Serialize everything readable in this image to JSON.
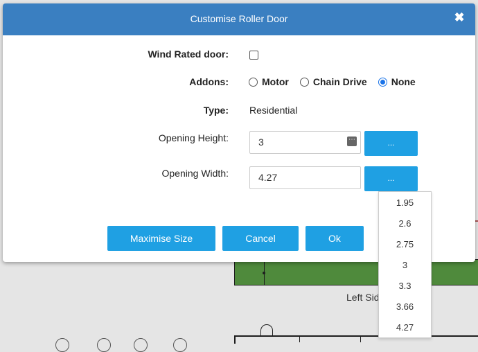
{
  "background": {
    "left_side_label": "Left Sid"
  },
  "modal": {
    "title": "Customise Roller Door",
    "close_glyph": "✖"
  },
  "form": {
    "wind_rated_label": "Wind Rated door:",
    "wind_rated_checked": false,
    "addons_label": "Addons:",
    "addons_options": [
      "Motor",
      "Chain Drive",
      "None"
    ],
    "addons_selected": "None",
    "type_label": "Type:",
    "type_value": "Residential",
    "opening_height_label": "Opening Height:",
    "opening_height_value": "3",
    "opening_width_label": "Opening Width:",
    "opening_width_value": "4.27",
    "dots_label": "..."
  },
  "footer": {
    "maximise_label": "Maximise Size",
    "cancel_label": "Cancel",
    "ok_label": "Ok"
  },
  "dropdown": {
    "options": [
      "1.95",
      "2.6",
      "2.75",
      "3",
      "3.3",
      "3.66",
      "4.27"
    ]
  },
  "colors": {
    "header": "#3a7fc1",
    "button": "#1fa0e3",
    "radio_checked": "#1a73e8",
    "floor_green": "#4f8a3c"
  }
}
